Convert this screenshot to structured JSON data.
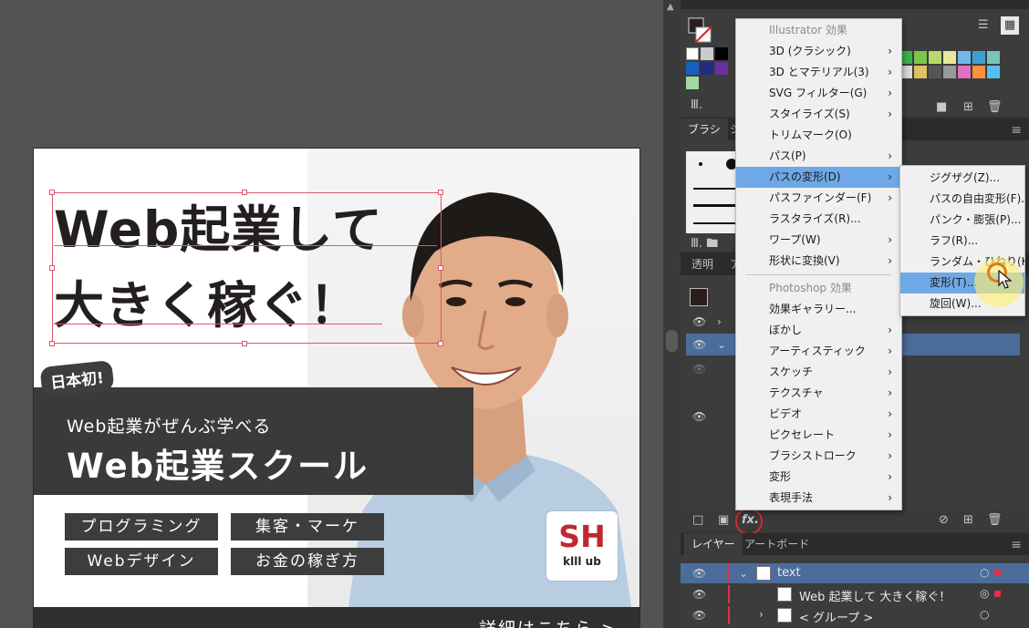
{
  "artboard": {
    "title_line1": "Web起業して",
    "title_line2": "大きく稼ぐ！",
    "badge": "日本初!",
    "school_sub": "Web起業がぜんぶ学べる",
    "school_name": "Web起業スクール",
    "tags": [
      "プログラミング",
      "集客・マーケ",
      "Webデザイン",
      "お金の稼ぎ方"
    ],
    "logo_mark": "SH",
    "logo_sub": "klll ub",
    "footer": "詳細はこちら >"
  },
  "panels": {
    "brush_tab": "ブラシ",
    "brush_tab2": "シ",
    "transparency_tab": "透明",
    "appearance_tab": "ア",
    "layers_tabs": [
      "レイヤー",
      "アートボード"
    ],
    "fx_label": "fx."
  },
  "effect_menu": {
    "illustrator_header": "Illustrator 効果",
    "illustrator_items": [
      "3D (クラシック)",
      "3D とマテリアル(3)",
      "SVG フィルター(G)",
      "スタイライズ(S)",
      "トリムマーク(O)",
      "パス(P)",
      "パスの変形(D)",
      "パスファインダー(F)",
      "ラスタライズ(R)...",
      "ワープ(W)",
      "形状に変換(V)"
    ],
    "photoshop_header": "Photoshop 効果",
    "photoshop_items": [
      "効果ギャラリー...",
      "ぼかし",
      "アーティスティック",
      "スケッチ",
      "テクスチャ",
      "ビデオ",
      "ピクセレート",
      "ブラシストローク",
      "変形",
      "表現手法"
    ]
  },
  "submenu": {
    "items": [
      "ジグザグ(Z)...",
      "パスの自由変形(F)...",
      "パンク・膨張(P)...",
      "ラフ(R)...",
      "ランダム・ひねり(K)...",
      "変形(T)...",
      "旋回(W)..."
    ]
  },
  "layers": {
    "rows": [
      {
        "name": "text"
      },
      {
        "name": "Web 起業して 大きく稼ぐ！"
      },
      {
        "name": "< グループ >"
      }
    ]
  },
  "colors": {
    "accent_red": "#e0314b",
    "menu_highlight": "#6ea8e6",
    "panel_bg": "#3c3c3c"
  }
}
